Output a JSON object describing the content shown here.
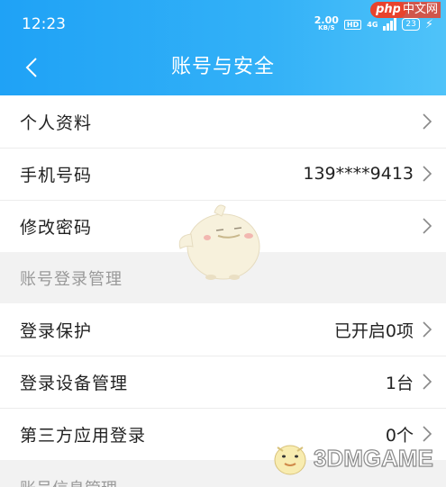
{
  "status_bar": {
    "time": "12:23",
    "speed_value": "2.00",
    "speed_unit": "KB/S",
    "hd": "HD",
    "network": "4G",
    "battery": "23"
  },
  "watermark_top": {
    "php": "php",
    "cn": "中文网"
  },
  "header": {
    "title": "账号与安全"
  },
  "rows_top": [
    {
      "label": "个人资料",
      "value": ""
    },
    {
      "label": "手机号码",
      "value": "139****9413"
    },
    {
      "label": "修改密码",
      "value": ""
    }
  ],
  "section_login": "账号登录管理",
  "rows_login": [
    {
      "label": "登录保护",
      "value": "已开启0项"
    },
    {
      "label": "登录设备管理",
      "value": "1台"
    },
    {
      "label": "第三方应用登录",
      "value": "0个"
    }
  ],
  "section_next": "账号信息管理",
  "watermark_bottom": "3DMGAME",
  "colors": {
    "header_start": "#1fa2f6",
    "header_end": "#4fc3f9",
    "text": "#222222",
    "muted": "#999999"
  }
}
